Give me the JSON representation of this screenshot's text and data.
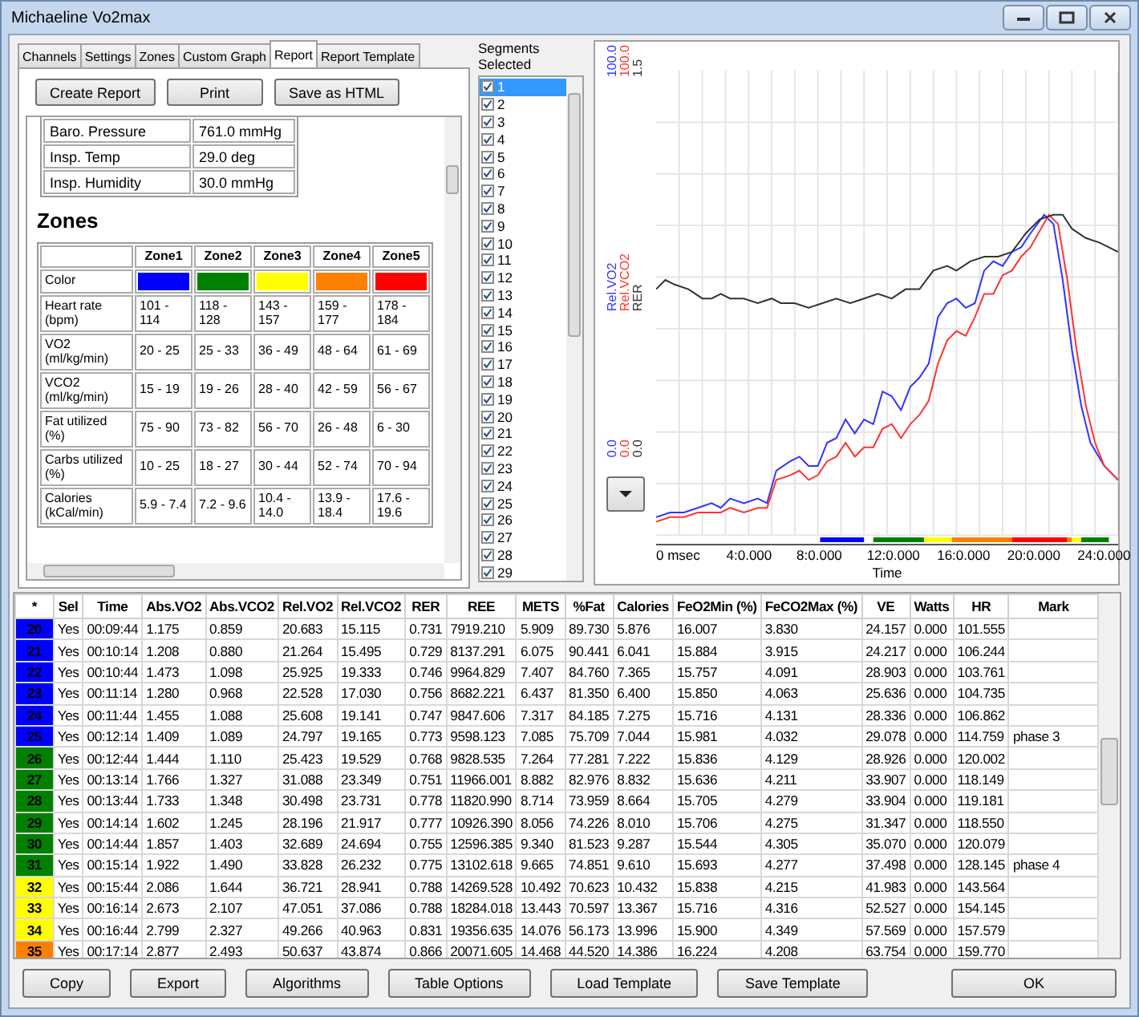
{
  "window": {
    "title": "Michaeline Vo2max"
  },
  "tabs": [
    {
      "label": "Channels",
      "selected": false
    },
    {
      "label": "Settings",
      "selected": false
    },
    {
      "label": "Zones",
      "selected": false
    },
    {
      "label": "Custom Graph",
      "selected": false
    },
    {
      "label": "Report",
      "selected": true
    },
    {
      "label": "Report Template",
      "selected": false
    }
  ],
  "report": {
    "buttons": [
      "Create Report",
      "Print",
      "Save as HTML"
    ],
    "conditions": [
      {
        "label": "Baro. Pressure",
        "value": "761.0 mmHg"
      },
      {
        "label": "Insp. Temp",
        "value": "29.0 deg"
      },
      {
        "label": "Insp. Humidity",
        "value": "30.0 mmHg"
      }
    ],
    "zones_heading": "Zones",
    "zones_table": {
      "columns": [
        "Zone1",
        "Zone2",
        "Zone3",
        "Zone4",
        "Zone5"
      ],
      "color_label": "Color",
      "color_cells": [
        {
          "color": "#0000ff"
        },
        {
          "color": "#008000"
        },
        {
          "color": "#ffff00"
        },
        {
          "color": "#ff8000"
        },
        {
          "color": "#ff0000"
        }
      ],
      "rows": [
        {
          "label": "Heart rate (bpm)",
          "values": [
            "101 - 114",
            "118 - 128",
            "143 - 157",
            "159 - 177",
            "178 - 184"
          ]
        },
        {
          "label": "VO2 (ml/kg/min)",
          "values": [
            "20 - 25",
            "25 - 33",
            "36 - 49",
            "48 - 64",
            "61 - 69"
          ]
        },
        {
          "label": "VCO2 (ml/kg/min)",
          "values": [
            "15 - 19",
            "19 - 26",
            "28 - 40",
            "42 - 59",
            "56 - 67"
          ]
        },
        {
          "label": "Fat utilized (%)",
          "values": [
            "75 - 90",
            "73 - 82",
            "56 - 70",
            "26 - 48",
            "6 - 30"
          ]
        },
        {
          "label": "Carbs utilized (%)",
          "values": [
            "10 - 25",
            "18 - 27",
            "30 - 44",
            "52 - 74",
            "70 - 94"
          ]
        },
        {
          "label": "Calories (kCal/min)",
          "values": [
            "5.9 - 7.4",
            "7.2 - 9.6",
            "10.4 - 14.0",
            "13.9 - 18.4",
            "17.6 - 19.6"
          ]
        }
      ]
    }
  },
  "segments": {
    "title": "Segments Selected",
    "items": [
      {
        "label": "1",
        "checked": true,
        "selected": true
      },
      {
        "label": "2",
        "checked": true,
        "selected": false
      },
      {
        "label": "3",
        "checked": true,
        "selected": false
      },
      {
        "label": "4",
        "checked": true,
        "selected": false
      },
      {
        "label": "5",
        "checked": true,
        "selected": false
      },
      {
        "label": "6",
        "checked": true,
        "selected": false
      },
      {
        "label": "7",
        "checked": true,
        "selected": false
      },
      {
        "label": "8",
        "checked": true,
        "selected": false
      },
      {
        "label": "9",
        "checked": true,
        "selected": false
      },
      {
        "label": "10",
        "checked": true,
        "selected": false
      },
      {
        "label": "11",
        "checked": true,
        "selected": false
      },
      {
        "label": "12",
        "checked": true,
        "selected": false
      },
      {
        "label": "13",
        "checked": true,
        "selected": false
      },
      {
        "label": "14",
        "checked": true,
        "selected": false
      },
      {
        "label": "15",
        "checked": true,
        "selected": false
      },
      {
        "label": "16",
        "checked": true,
        "selected": false
      },
      {
        "label": "17",
        "checked": true,
        "selected": false
      },
      {
        "label": "18",
        "checked": true,
        "selected": false
      },
      {
        "label": "19",
        "checked": true,
        "selected": false
      },
      {
        "label": "20",
        "checked": true,
        "selected": false
      },
      {
        "label": "21",
        "checked": true,
        "selected": false
      },
      {
        "label": "22",
        "checked": true,
        "selected": false
      },
      {
        "label": "23",
        "checked": true,
        "selected": false
      },
      {
        "label": "24",
        "checked": true,
        "selected": false
      },
      {
        "label": "25",
        "checked": true,
        "selected": false
      },
      {
        "label": "26",
        "checked": true,
        "selected": false
      },
      {
        "label": "27",
        "checked": true,
        "selected": false
      },
      {
        "label": "28",
        "checked": true,
        "selected": false
      },
      {
        "label": "29",
        "checked": true,
        "selected": false
      }
    ]
  },
  "chart": {
    "series": [
      {
        "name": "Rel.VO2",
        "max": "100.0",
        "min": "0.0",
        "color": "#3333ff"
      },
      {
        "name": "Rel.VCO2",
        "max": "100.0",
        "min": "0.0",
        "color": "#ff3333"
      },
      {
        "name": "RER",
        "max": "1.5",
        "min": "0.0",
        "color": "#333333"
      }
    ],
    "x_ticks": [
      "0 msec",
      "4:0.000",
      "8:0.000",
      "12:0.000",
      "16:0.000",
      "20:0.000",
      "24:0.000"
    ],
    "xlabel": "Time"
  },
  "table": {
    "columns": [
      "*",
      "Sel",
      "Time",
      "Abs.VO2",
      "Abs.VCO2",
      "Rel.VO2",
      "Rel.VCO2",
      "RER",
      "REE",
      "METS",
      "%Fat",
      "Calories",
      "FeO2Min (%)",
      "FeCO2Max (%)",
      "VE",
      "Watts",
      "HR",
      "Mark"
    ],
    "rows": [
      {
        "color": "#0000ff",
        "cells": [
          "20",
          "Yes",
          "00:09:44",
          "1.175",
          "0.859",
          "20.683",
          "15.115",
          "0.731",
          "7919.210",
          "5.909",
          "89.730",
          "5.876",
          "16.007",
          "3.830",
          "24.157",
          "0.000",
          "101.555",
          ""
        ]
      },
      {
        "color": "#0000ff",
        "cells": [
          "21",
          "Yes",
          "00:10:14",
          "1.208",
          "0.880",
          "21.264",
          "15.495",
          "0.729",
          "8137.291",
          "6.075",
          "90.441",
          "6.041",
          "15.884",
          "3.915",
          "24.217",
          "0.000",
          "106.244",
          ""
        ]
      },
      {
        "color": "#0000ff",
        "cells": [
          "22",
          "Yes",
          "00:10:44",
          "1.473",
          "1.098",
          "25.925",
          "19.333",
          "0.746",
          "9964.829",
          "7.407",
          "84.760",
          "7.365",
          "15.757",
          "4.091",
          "28.903",
          "0.000",
          "103.761",
          ""
        ]
      },
      {
        "color": "#0000ff",
        "cells": [
          "23",
          "Yes",
          "00:11:14",
          "1.280",
          "0.968",
          "22.528",
          "17.030",
          "0.756",
          "8682.221",
          "6.437",
          "81.350",
          "6.400",
          "15.850",
          "4.063",
          "25.636",
          "0.000",
          "104.735",
          ""
        ]
      },
      {
        "color": "#0000ff",
        "cells": [
          "24",
          "Yes",
          "00:11:44",
          "1.455",
          "1.088",
          "25.608",
          "19.141",
          "0.747",
          "9847.606",
          "7.317",
          "84.185",
          "7.275",
          "15.716",
          "4.131",
          "28.336",
          "0.000",
          "106.862",
          ""
        ]
      },
      {
        "color": "#0000ff",
        "cells": [
          "25",
          "Yes",
          "00:12:14",
          "1.409",
          "1.089",
          "24.797",
          "19.165",
          "0.773",
          "9598.123",
          "7.085",
          "75.709",
          "7.044",
          "15.981",
          "4.032",
          "29.078",
          "0.000",
          "114.759",
          "phase 3"
        ]
      },
      {
        "color": "#008000",
        "cells": [
          "26",
          "Yes",
          "00:12:44",
          "1.444",
          "1.110",
          "25.423",
          "19.529",
          "0.768",
          "9828.535",
          "7.264",
          "77.281",
          "7.222",
          "15.836",
          "4.129",
          "28.926",
          "0.000",
          "120.002",
          ""
        ]
      },
      {
        "color": "#008000",
        "cells": [
          "27",
          "Yes",
          "00:13:14",
          "1.766",
          "1.327",
          "31.088",
          "23.349",
          "0.751",
          "11966.001",
          "8.882",
          "82.976",
          "8.832",
          "15.636",
          "4.211",
          "33.907",
          "0.000",
          "118.149",
          ""
        ]
      },
      {
        "color": "#008000",
        "cells": [
          "28",
          "Yes",
          "00:13:44",
          "1.733",
          "1.348",
          "30.498",
          "23.731",
          "0.778",
          "11820.990",
          "8.714",
          "73.959",
          "8.664",
          "15.705",
          "4.279",
          "33.904",
          "0.000",
          "119.181",
          ""
        ]
      },
      {
        "color": "#008000",
        "cells": [
          "29",
          "Yes",
          "00:14:14",
          "1.602",
          "1.245",
          "28.196",
          "21.917",
          "0.777",
          "10926.390",
          "8.056",
          "74.226",
          "8.010",
          "15.706",
          "4.275",
          "31.347",
          "0.000",
          "118.550",
          ""
        ]
      },
      {
        "color": "#008000",
        "cells": [
          "30",
          "Yes",
          "00:14:44",
          "1.857",
          "1.403",
          "32.689",
          "24.694",
          "0.755",
          "12596.385",
          "9.340",
          "81.523",
          "9.287",
          "15.544",
          "4.305",
          "35.070",
          "0.000",
          "120.079",
          ""
        ]
      },
      {
        "color": "#008000",
        "cells": [
          "31",
          "Yes",
          "00:15:14",
          "1.922",
          "1.490",
          "33.828",
          "26.232",
          "0.775",
          "13102.618",
          "9.665",
          "74.851",
          "9.610",
          "15.693",
          "4.277",
          "37.498",
          "0.000",
          "128.145",
          "phase 4"
        ]
      },
      {
        "color": "#ffff00",
        "cells": [
          "32",
          "Yes",
          "00:15:44",
          "2.086",
          "1.644",
          "36.721",
          "28.941",
          "0.788",
          "14269.528",
          "10.492",
          "70.623",
          "10.432",
          "15.838",
          "4.215",
          "41.983",
          "0.000",
          "143.564",
          ""
        ]
      },
      {
        "color": "#ffff00",
        "cells": [
          "33",
          "Yes",
          "00:16:14",
          "2.673",
          "2.107",
          "47.051",
          "37.086",
          "0.788",
          "18284.018",
          "13.443",
          "70.597",
          "13.367",
          "15.716",
          "4.316",
          "52.527",
          "0.000",
          "154.145",
          ""
        ]
      },
      {
        "color": "#ffff00",
        "cells": [
          "34",
          "Yes",
          "00:16:44",
          "2.799",
          "2.327",
          "49.266",
          "40.963",
          "0.831",
          "19356.635",
          "14.076",
          "56.173",
          "13.996",
          "15.900",
          "4.349",
          "57.569",
          "0.000",
          "157.579",
          ""
        ]
      },
      {
        "color": "#ff8000",
        "cells": [
          "35",
          "Yes",
          "00:17:14",
          "2.877",
          "2.493",
          "50.637",
          "43.874",
          "0.866",
          "20071.605",
          "14.468",
          "44.520",
          "14.386",
          "16.224",
          "4.208",
          "63.754",
          "0.000",
          "159.770",
          ""
        ]
      }
    ]
  },
  "buttons": [
    "Copy",
    "Export",
    "Algorithms",
    "Table Options",
    "Load Template",
    "Save Template",
    "OK"
  ]
}
